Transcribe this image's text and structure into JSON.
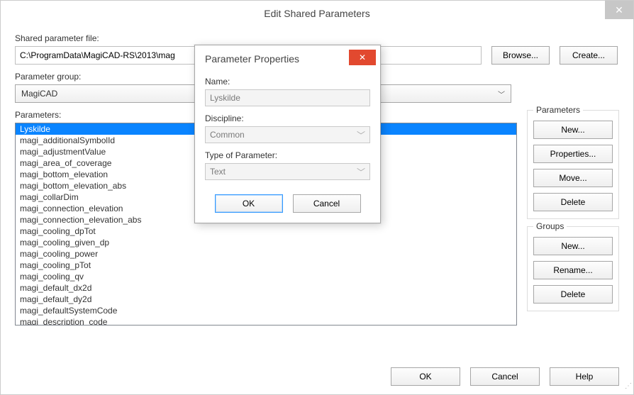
{
  "window": {
    "title": "Edit Shared Parameters",
    "close_glyph": "✕"
  },
  "file": {
    "label": "Shared parameter file:",
    "path": "C:\\ProgramData\\MagiCAD-RS\\2013\\mag",
    "browse": "Browse...",
    "create": "Create..."
  },
  "group": {
    "label": "Parameter group:",
    "selected": "MagiCAD"
  },
  "params": {
    "label": "Parameters:",
    "items": [
      "Lyskilde",
      "magi_additionalSymbolId",
      "magi_adjustmentValue",
      "magi_area_of_coverage",
      "magi_bottom_elevation",
      "magi_bottom_elevation_abs",
      "magi_collarDim",
      "magi_connection_elevation",
      "magi_connection_elevation_abs",
      "magi_cooling_dpTot",
      "magi_cooling_given_dp",
      "magi_cooling_power",
      "magi_cooling_pTot",
      "magi_cooling_qv",
      "magi_default_dx2d",
      "magi_default_dy2d",
      "magi_defaultSystemCode",
      "magi_description_code"
    ],
    "selected_index": 0
  },
  "side": {
    "parameters_title": "Parameters",
    "new": "New...",
    "properties": "Properties...",
    "move": "Move...",
    "delete": "Delete",
    "groups_title": "Groups",
    "g_new": "New...",
    "g_rename": "Rename...",
    "g_delete": "Delete"
  },
  "footer": {
    "ok": "OK",
    "cancel": "Cancel",
    "help": "Help"
  },
  "modal": {
    "title": "Parameter Properties",
    "close_glyph": "✕",
    "name_label": "Name:",
    "name_value": "Lyskilde",
    "discipline_label": "Discipline:",
    "discipline_value": "Common",
    "type_label": "Type of Parameter:",
    "type_value": "Text",
    "ok": "OK",
    "cancel": "Cancel"
  }
}
